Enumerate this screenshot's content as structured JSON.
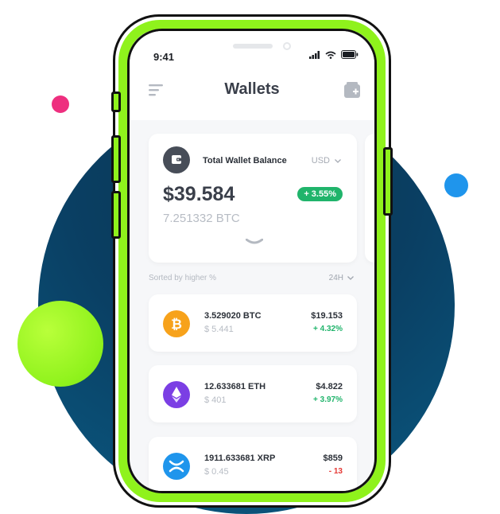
{
  "status_bar": {
    "time": "9:41"
  },
  "header": {
    "title": "Wallets"
  },
  "balance": {
    "label": "Total Wallet Balance",
    "currency": "USD",
    "amount": "$39.584",
    "btc": "7.251332 BTC",
    "change": "+ 3.55%"
  },
  "list": {
    "sort_label": "Sorted by higher %",
    "period": "24H"
  },
  "assets": [
    {
      "amount": "3.529020 BTC",
      "usd": "$ 5.441",
      "price": "$19.153",
      "change": "+ 4.32%",
      "icon": "bitcoin-icon",
      "color": "#f7a21b",
      "change_color": "#20b46b"
    },
    {
      "amount": "12.633681 ETH",
      "usd": "$ 401",
      "price": "$4.822",
      "change": "+ 3.97%",
      "icon": "ethereum-icon",
      "color": "#7b3fe4",
      "change_color": "#20b46b"
    },
    {
      "amount": "1911.633681 XRP",
      "usd": "$ 0.45",
      "price": "$859",
      "change": "- 13",
      "icon": "ripple-icon",
      "color": "#1f95ec",
      "change_color": "#e53935"
    }
  ]
}
